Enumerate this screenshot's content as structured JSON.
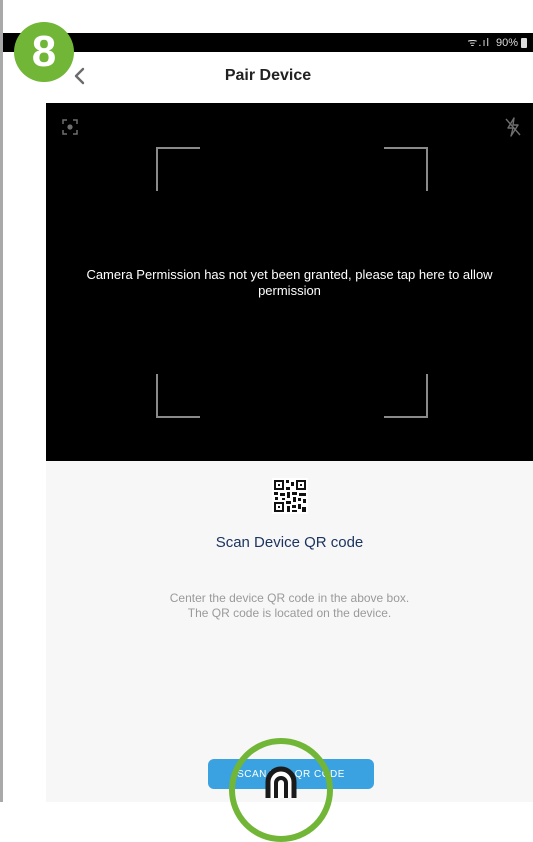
{
  "status_bar": {
    "signal": "ᯤ.ıl",
    "battery": "90%"
  },
  "step_badge": {
    "number": "8",
    "color": "#71b637"
  },
  "header": {
    "back_glyph": "‹",
    "title": "Pair Device"
  },
  "camera": {
    "permission_line1": "Camera Permission has not yet been granted, please tap here to allow",
    "permission_line2": "permission"
  },
  "content": {
    "scan_title": "Scan Device QR code",
    "instruction_line1": "Center the device QR code in the above box.",
    "instruction_line2": "The QR code is located on the device.",
    "scan_button_label": "SCAN THE QR CODE"
  },
  "colors": {
    "accent_blue": "#3aa2e0",
    "title_navy": "#1c3560",
    "badge_green": "#71b637"
  }
}
